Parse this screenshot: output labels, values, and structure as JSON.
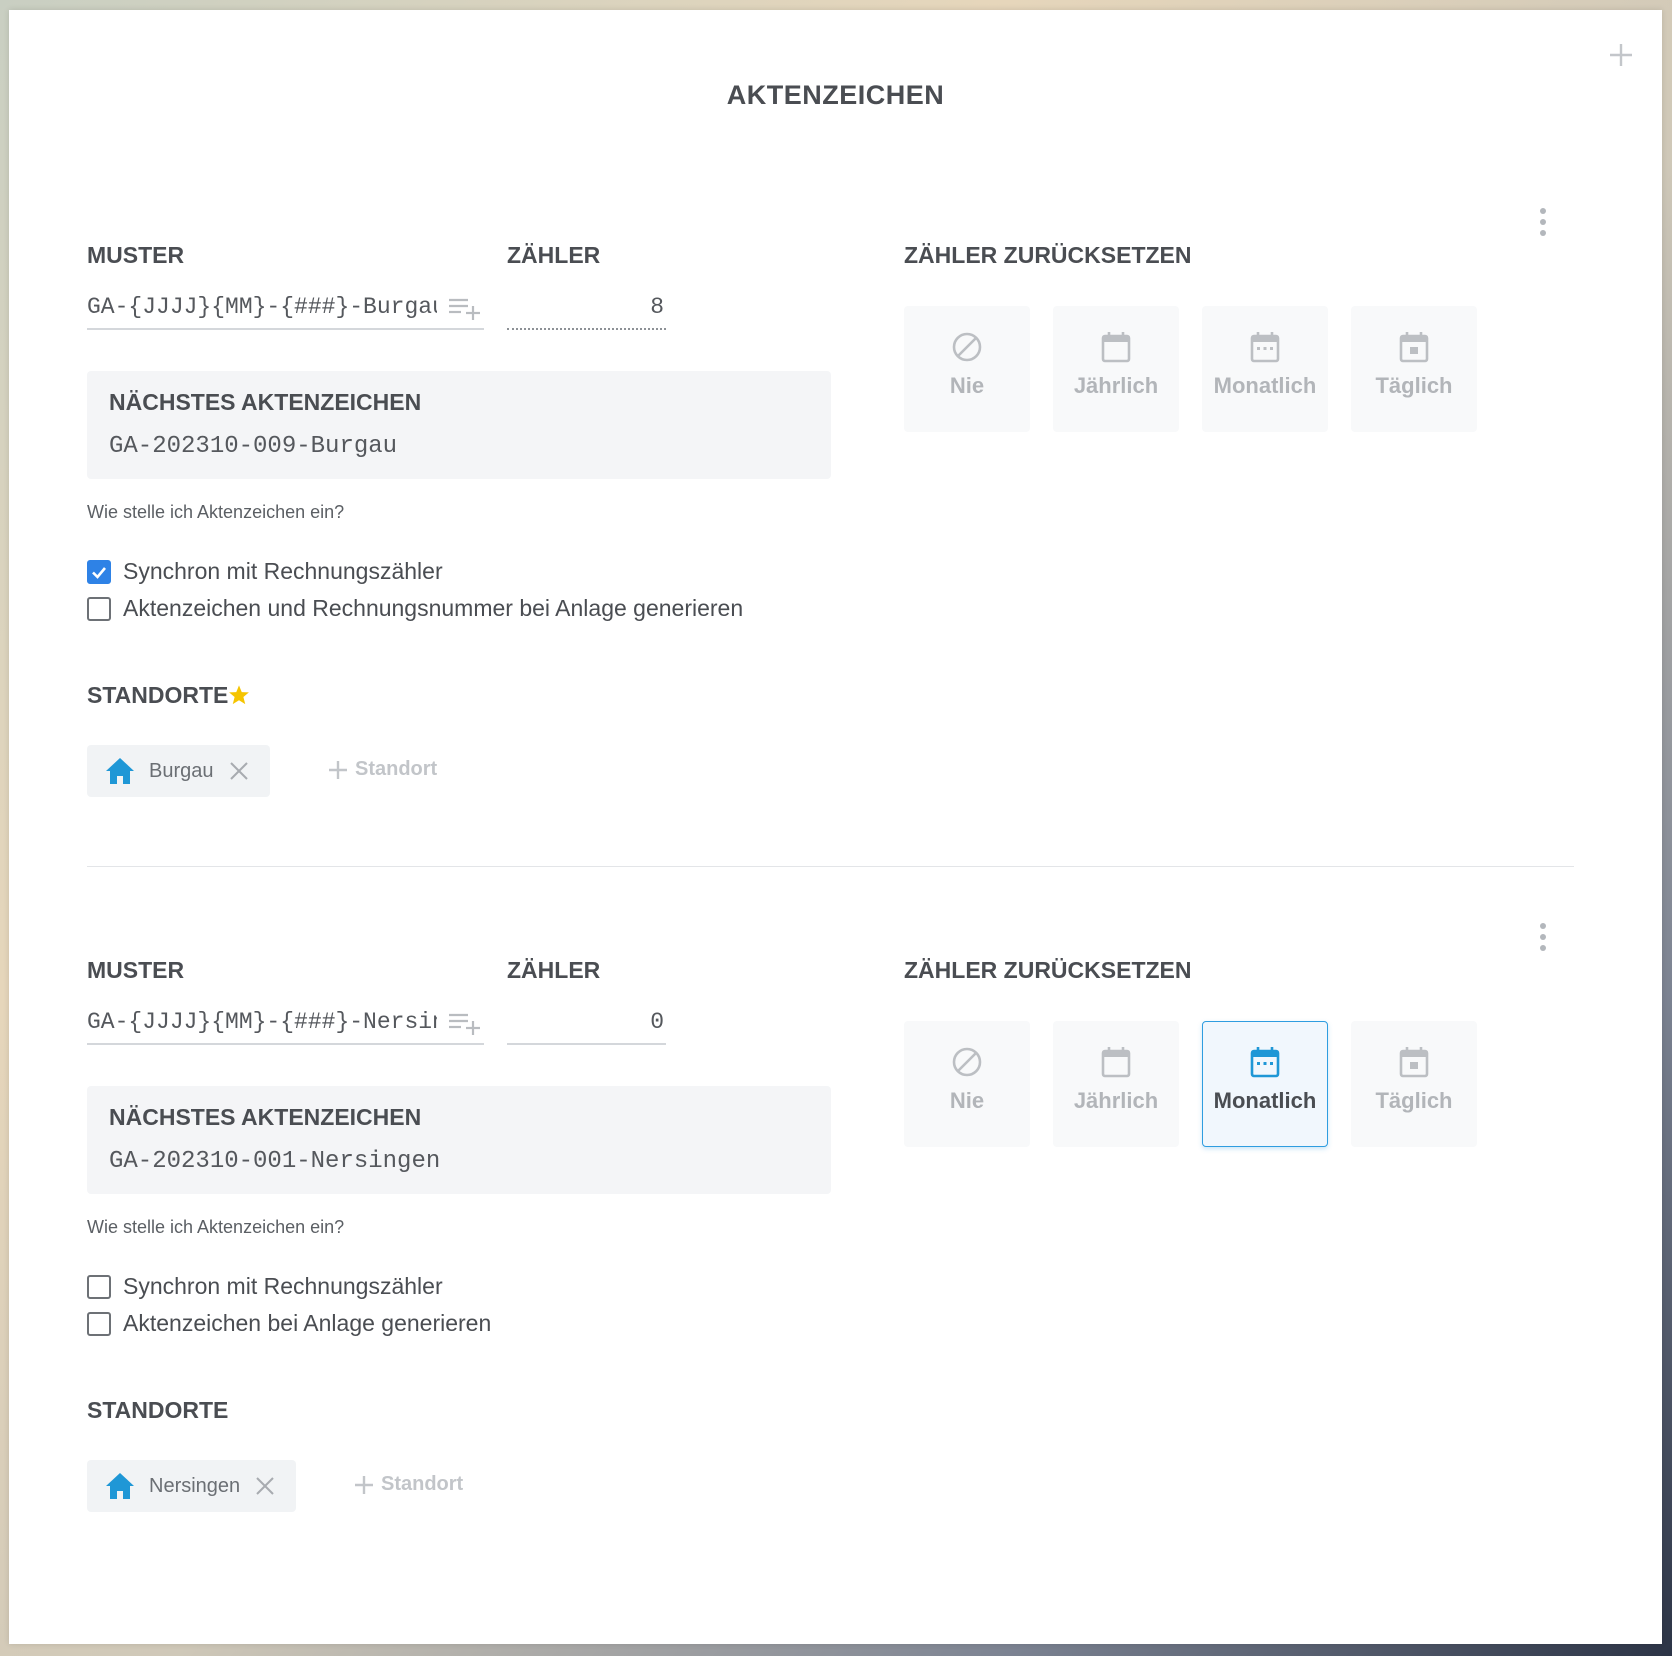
{
  "page": {
    "title": "AKTENZEICHEN"
  },
  "colors": {
    "accent": "#2f9de0",
    "checkbox_checked": "#2e82e6",
    "star": "#f5c400",
    "muted": "#b2b5b9"
  },
  "sections": [
    {
      "muster_label": "MUSTER",
      "muster_value": "GA-{JJJJ}{MM}-{###}-Burgau",
      "zaehler_label": "ZÄHLER",
      "zaehler_value": "8",
      "reset_label": "ZÄHLER ZURÜCKSETZEN",
      "reset_options": [
        "Nie",
        "Jährlich",
        "Monatlich",
        "Täglich"
      ],
      "reset_selected": "",
      "next_label": "NÄCHSTES AKTENZEICHEN",
      "next_value": "GA-202310-009-Burgau",
      "help_link": "Wie stelle ich Aktenzeichen ein?",
      "checkboxes": [
        {
          "label": "Synchron mit Rechnungszähler",
          "checked": true
        },
        {
          "label": "Aktenzeichen und Rechnungsnummer bei Anlage generieren",
          "checked": false
        }
      ],
      "standorte_label": "STANDORTE",
      "standorte_starred": true,
      "standorte": [
        "Burgau"
      ],
      "add_standort_label": "Standort"
    },
    {
      "muster_label": "MUSTER",
      "muster_value": "GA-{JJJJ}{MM}-{###}-Nersingen",
      "zaehler_label": "ZÄHLER",
      "zaehler_value": "0",
      "reset_label": "ZÄHLER ZURÜCKSETZEN",
      "reset_options": [
        "Nie",
        "Jährlich",
        "Monatlich",
        "Täglich"
      ],
      "reset_selected": "Monatlich",
      "next_label": "NÄCHSTES AKTENZEICHEN",
      "next_value": "GA-202310-001-Nersingen",
      "help_link": "Wie stelle ich Aktenzeichen ein?",
      "checkboxes": [
        {
          "label": "Synchron mit Rechnungszähler",
          "checked": false
        },
        {
          "label": "Aktenzeichen bei Anlage generieren",
          "checked": false
        }
      ],
      "standorte_label": "STANDORTE",
      "standorte_starred": false,
      "standorte": [
        "Nersingen"
      ],
      "add_standort_label": "Standort"
    }
  ],
  "icons": {
    "corner": "plus-icon",
    "menu": "more-vertical-icon",
    "muster_insert": "playlist-add-icon",
    "reset": [
      "block-icon",
      "calendar-blank-icon",
      "calendar-month-icon",
      "calendar-today-icon"
    ],
    "standort": "home-icon",
    "remove": "close-icon",
    "star": "star-icon"
  }
}
